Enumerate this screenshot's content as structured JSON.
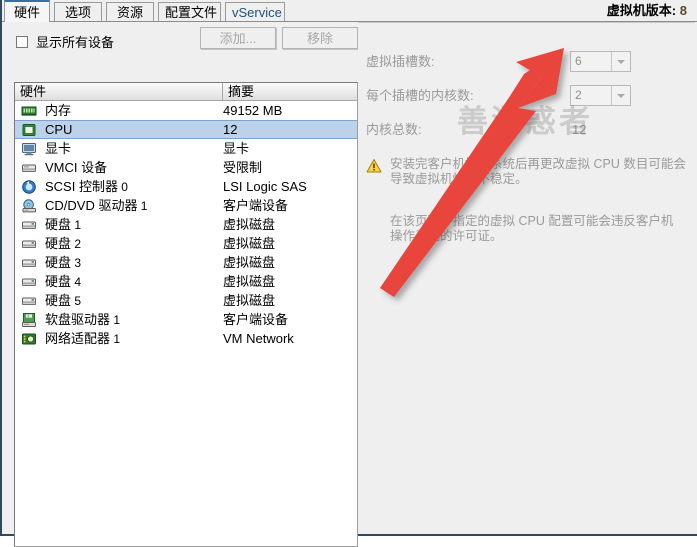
{
  "tabs": [
    {
      "label": "硬件",
      "active": true
    },
    {
      "label": "选项",
      "active": false
    },
    {
      "label": "资源",
      "active": false
    },
    {
      "label": "配置文件",
      "active": false
    },
    {
      "label": "vService",
      "active": false
    }
  ],
  "toolbar": {
    "show_all_devices_label": "显示所有设备",
    "show_all_devices_checked": false,
    "add_label": "添加...",
    "remove_label": "移除"
  },
  "device_list": {
    "columns": [
      "硬件",
      "摘要"
    ],
    "rows": [
      {
        "icon": "memory-icon",
        "name": "内存",
        "index": "",
        "summary": "49152 MB",
        "selected": false
      },
      {
        "icon": "cpu-icon",
        "name": "CPU",
        "index": "",
        "summary": "12",
        "selected": true
      },
      {
        "icon": "display-icon",
        "name": "显卡",
        "index": "",
        "summary": "显卡",
        "selected": false
      },
      {
        "icon": "vmci-icon",
        "name": "VMCI 设备",
        "index": "",
        "summary": "受限制",
        "selected": false
      },
      {
        "icon": "scsi-controller-icon",
        "name": "SCSI 控制器",
        "index": "0",
        "summary": "LSI Logic SAS",
        "selected": false
      },
      {
        "icon": "cddvd-icon",
        "name": "CD/DVD 驱动器",
        "index": "1",
        "summary": "客户端设备",
        "selected": false
      },
      {
        "icon": "harddisk-icon",
        "name": "硬盘",
        "index": "1",
        "summary": "虚拟磁盘",
        "selected": false
      },
      {
        "icon": "harddisk-icon",
        "name": "硬盘",
        "index": "2",
        "summary": "虚拟磁盘",
        "selected": false
      },
      {
        "icon": "harddisk-icon",
        "name": "硬盘",
        "index": "3",
        "summary": "虚拟磁盘",
        "selected": false
      },
      {
        "icon": "harddisk-icon",
        "name": "硬盘",
        "index": "4",
        "summary": "虚拟磁盘",
        "selected": false
      },
      {
        "icon": "harddisk-icon",
        "name": "硬盘",
        "index": "5",
        "summary": "虚拟磁盘",
        "selected": false
      },
      {
        "icon": "floppy-icon",
        "name": "软盘驱动器",
        "index": "1",
        "summary": "客户端设备",
        "selected": false
      },
      {
        "icon": "network-adapter-icon",
        "name": "网络适配器",
        "index": "1",
        "summary": "VM Network",
        "selected": false
      }
    ]
  },
  "details": {
    "vm_version_label": "虚拟机版本:",
    "vm_version_value": "8",
    "sockets_label": "虚拟插槽数:",
    "sockets_value": "6",
    "cores_per_socket_label": "每个插槽的内核数:",
    "cores_per_socket_value": "2",
    "total_cores_label": "内核总数:",
    "total_cores_value": "12",
    "warning_text": "安装完客户机操作系统后再更改虚拟 CPU 数目可能会导致虚拟机性能不稳定。",
    "license_note": "在该页面中指定的虚拟 CPU 配置可能会违反客户机操作系统的许可证。"
  },
  "annotation": {
    "watermark_text": "善游惑者",
    "arrow_color": "#e8453c"
  }
}
